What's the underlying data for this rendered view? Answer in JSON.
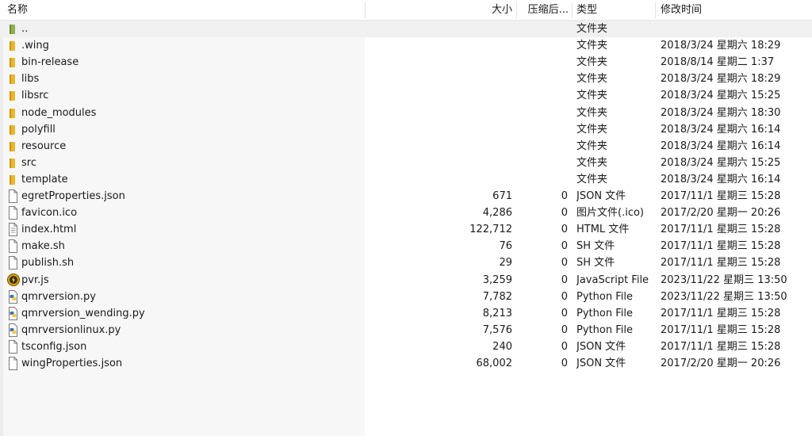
{
  "header": {
    "name": "名称",
    "size": "大小",
    "compressed": "压缩后...",
    "type": "类型",
    "modified": "修改时间"
  },
  "colors": {
    "folder_yellow": "#e8b82a",
    "parent_green": "#8fb04a",
    "file_outline": "#7a7a7a",
    "python_blue": "#3a73b5",
    "python_yellow": "#f2c73b",
    "js_badge": "#d6a400"
  },
  "files": [
    {
      "icon": "parent-folder-icon",
      "name": "..",
      "size": "",
      "compressed": "",
      "type": "文件夹",
      "modified": ""
    },
    {
      "icon": "folder-icon",
      "name": ".wing",
      "size": "",
      "compressed": "",
      "type": "文件夹",
      "modified": "2018/3/24 星期六 18:29"
    },
    {
      "icon": "folder-icon",
      "name": "bin-release",
      "size": "",
      "compressed": "",
      "type": "文件夹",
      "modified": "2018/8/14 星期二 1:37"
    },
    {
      "icon": "folder-icon",
      "name": "libs",
      "size": "",
      "compressed": "",
      "type": "文件夹",
      "modified": "2018/3/24 星期六 18:29"
    },
    {
      "icon": "folder-icon",
      "name": "libsrc",
      "size": "",
      "compressed": "",
      "type": "文件夹",
      "modified": "2018/3/24 星期六 15:25"
    },
    {
      "icon": "folder-icon",
      "name": "node_modules",
      "size": "",
      "compressed": "",
      "type": "文件夹",
      "modified": "2018/3/24 星期六 18:30"
    },
    {
      "icon": "folder-icon",
      "name": "polyfill",
      "size": "",
      "compressed": "",
      "type": "文件夹",
      "modified": "2018/3/24 星期六 16:14"
    },
    {
      "icon": "folder-icon",
      "name": "resource",
      "size": "",
      "compressed": "",
      "type": "文件夹",
      "modified": "2018/3/24 星期六 16:14"
    },
    {
      "icon": "folder-icon",
      "name": "src",
      "size": "",
      "compressed": "",
      "type": "文件夹",
      "modified": "2018/3/24 星期六 15:25"
    },
    {
      "icon": "folder-icon",
      "name": "template",
      "size": "",
      "compressed": "",
      "type": "文件夹",
      "modified": "2018/3/24 星期六 16:14"
    },
    {
      "icon": "file-icon",
      "name": "egretProperties.json",
      "size": "671",
      "compressed": "0",
      "type": "JSON 文件",
      "modified": "2017/11/1 星期三 15:28"
    },
    {
      "icon": "file-icon",
      "name": "favicon.ico",
      "size": "4,286",
      "compressed": "0",
      "type": "图片文件(.ico)",
      "modified": "2017/2/20 星期一 20:26"
    },
    {
      "icon": "text-file-icon",
      "name": "index.html",
      "size": "122,712",
      "compressed": "0",
      "type": "HTML 文件",
      "modified": "2017/11/1 星期三 15:28"
    },
    {
      "icon": "file-icon",
      "name": "make.sh",
      "size": "76",
      "compressed": "0",
      "type": "SH 文件",
      "modified": "2017/11/1 星期三 15:28"
    },
    {
      "icon": "file-icon",
      "name": "publish.sh",
      "size": "29",
      "compressed": "0",
      "type": "SH 文件",
      "modified": "2017/11/1 星期三 15:28"
    },
    {
      "icon": "javascript-file-icon",
      "name": "pvr.js",
      "size": "3,259",
      "compressed": "0",
      "type": "JavaScript File",
      "modified": "2023/11/22 星期三 13:50"
    },
    {
      "icon": "python-file-icon",
      "name": "qmrversion.py",
      "size": "7,782",
      "compressed": "0",
      "type": "Python File",
      "modified": "2023/11/22 星期三 13:50"
    },
    {
      "icon": "python-file-icon",
      "name": "qmrversion_wending.py",
      "size": "8,213",
      "compressed": "0",
      "type": "Python File",
      "modified": "2017/11/1 星期三 15:28"
    },
    {
      "icon": "python-file-icon",
      "name": "qmrversionlinux.py",
      "size": "7,576",
      "compressed": "0",
      "type": "Python File",
      "modified": "2017/11/1 星期三 15:28"
    },
    {
      "icon": "file-icon",
      "name": "tsconfig.json",
      "size": "240",
      "compressed": "0",
      "type": "JSON 文件",
      "modified": "2017/11/1 星期三 15:28"
    },
    {
      "icon": "file-icon",
      "name": "wingProperties.json",
      "size": "68,002",
      "compressed": "0",
      "type": "JSON 文件",
      "modified": "2017/2/20 星期一 20:26"
    }
  ]
}
